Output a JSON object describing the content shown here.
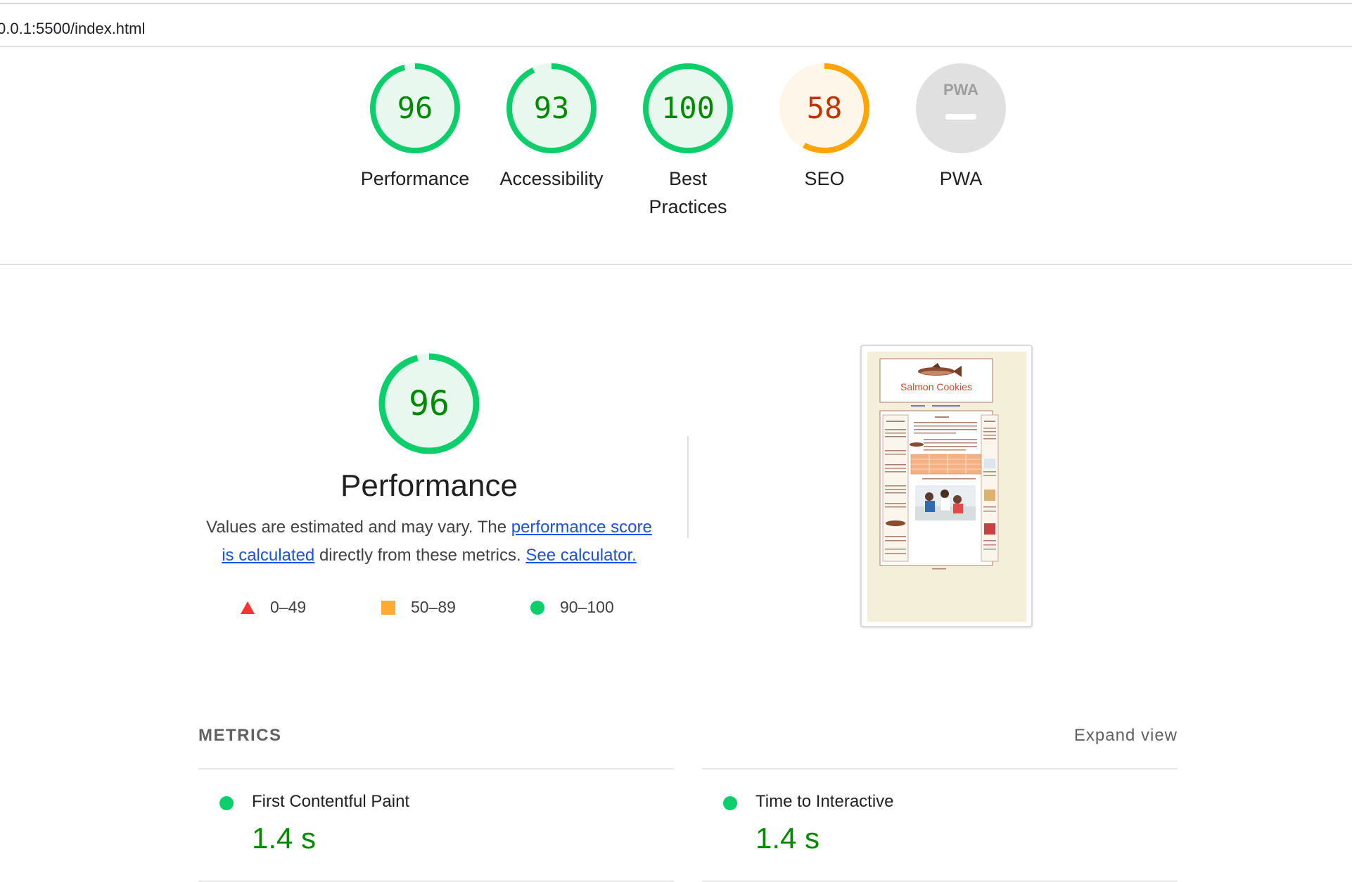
{
  "browser": {
    "url": "0.0.1:5500/index.html"
  },
  "categories": [
    {
      "name": "Performance",
      "score": 96,
      "rating": "pass"
    },
    {
      "name": "Accessibility",
      "score": 93,
      "rating": "pass"
    },
    {
      "name": "Best Practices",
      "score": 100,
      "rating": "pass"
    },
    {
      "name": "SEO",
      "score": 58,
      "rating": "average"
    },
    {
      "name": "PWA",
      "score": null,
      "badge_text": "PWA",
      "rating": "na"
    }
  ],
  "colors": {
    "pass": "#0cce6b",
    "pass_text": "#008800",
    "pass_fill": "#e8f8ef",
    "average": "#ffa400",
    "average_text": "#c33300",
    "average_fill": "#fff6ea",
    "fail": "#ff3333",
    "na_fill": "#e0e0e0",
    "link": "#1a52e6"
  },
  "performance": {
    "score": 96,
    "title": "Performance",
    "desc_prefix": "Values are estimated and may vary. The ",
    "desc_link1": "performance score is calculated",
    "desc_middle": " directly from these metrics. ",
    "desc_link2": "See calculator.",
    "legend": [
      {
        "shape": "triangle",
        "range": "0–49"
      },
      {
        "shape": "square",
        "range": "50–89"
      },
      {
        "shape": "circle",
        "range": "90–100"
      }
    ]
  },
  "thumbnail": {
    "site_title": "Salmon Cookies",
    "icon": "salmon-fish-icon"
  },
  "metrics": {
    "title": "METRICS",
    "expand_label": "Expand view",
    "items": [
      {
        "name": "First Contentful Paint",
        "value": "1.4 s"
      },
      {
        "name": "Time to Interactive",
        "value": "1.4 s"
      }
    ]
  }
}
